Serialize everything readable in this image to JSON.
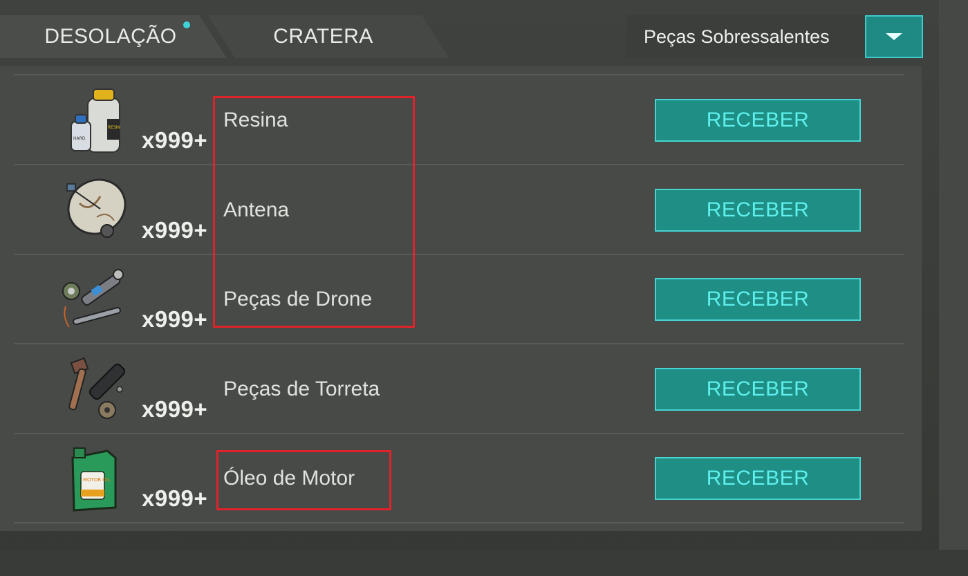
{
  "tabs": [
    {
      "label": "DESOLAÇÃO",
      "active": true,
      "has_notification": true
    },
    {
      "label": "CRATERA",
      "active": false
    }
  ],
  "dropdown": {
    "selected": "Peças Sobressalentes",
    "icon": "chevron-down-icon"
  },
  "items": [
    {
      "name": "Resina",
      "quantity": "x999+",
      "button": "RECEBER",
      "icon": "resin-bottles-icon"
    },
    {
      "name": "Antena",
      "quantity": "x999+",
      "button": "RECEBER",
      "icon": "satellite-dish-icon"
    },
    {
      "name": "Peças de Drone",
      "quantity": "x999+",
      "button": "RECEBER",
      "icon": "drone-parts-icon"
    },
    {
      "name": "Peças de Torreta",
      "quantity": "x999+",
      "button": "RECEBER",
      "icon": "turret-parts-icon"
    },
    {
      "name": "Óleo de Motor",
      "quantity": "x999+",
      "button": "RECEBER",
      "icon": "motor-oil-icon"
    }
  ],
  "icon_labels": {
    "resin_small": "HARD",
    "resin_big": "RESIN",
    "oil": "MOTOR OIL"
  },
  "colors": {
    "accent": "#1f8f86",
    "accent_border": "#45d4d2",
    "button_text": "#5ef0ec",
    "highlight_box": "#e0232a"
  }
}
